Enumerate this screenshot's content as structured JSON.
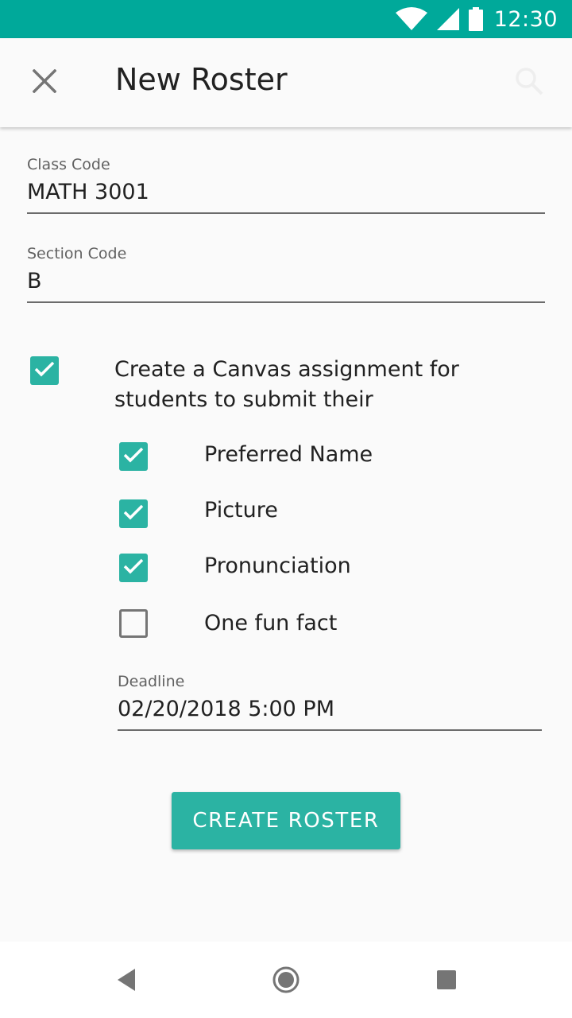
{
  "status_bar": {
    "time": "12:30",
    "icons": [
      "wifi-icon",
      "cell-signal-icon",
      "battery-icon"
    ]
  },
  "app_bar": {
    "title": "New Roster",
    "close_icon": "close-icon",
    "search_icon": "search-icon"
  },
  "form": {
    "class_code": {
      "label": "Class Code",
      "value": "MATH 3001"
    },
    "section_code": {
      "label": "Section Code",
      "value": "B"
    },
    "canvas_assignment": {
      "checked": true,
      "label": "Create a Canvas assignment for students to submit their"
    },
    "options": [
      {
        "label": "Preferred Name",
        "checked": true
      },
      {
        "label": "Picture",
        "checked": true
      },
      {
        "label": "Pronunciation",
        "checked": true
      },
      {
        "label": "One fun fact",
        "checked": false
      }
    ],
    "deadline": {
      "label": "Deadline",
      "value": "02/20/2018 5:00 PM"
    }
  },
  "actions": {
    "create_label": "CREATE ROSTER"
  },
  "nav_bar": {
    "icons": [
      "back-icon",
      "home-icon",
      "recents-icon"
    ]
  },
  "colors": {
    "status_bar": "#00a99a",
    "accent": "#2bb3a3",
    "background": "#fafafa"
  }
}
